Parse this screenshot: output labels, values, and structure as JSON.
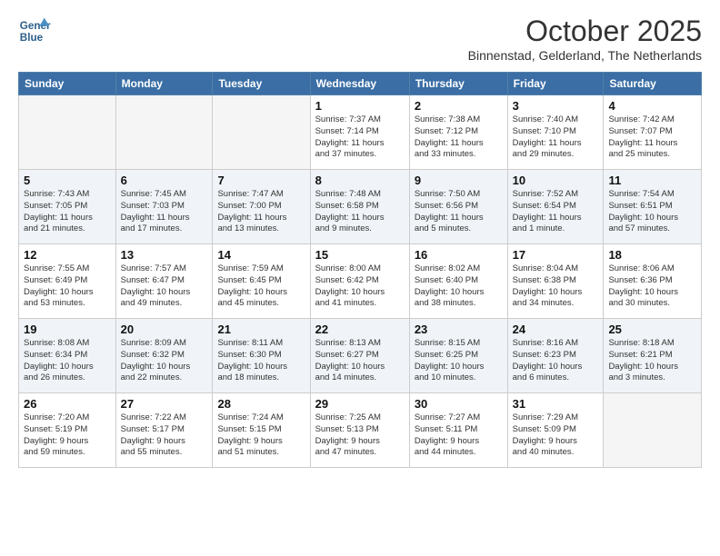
{
  "logo": {
    "text_line1": "General",
    "text_line2": "Blue"
  },
  "title": "October 2025",
  "location": "Binnenstad, Gelderland, The Netherlands",
  "weekdays": [
    "Sunday",
    "Monday",
    "Tuesday",
    "Wednesday",
    "Thursday",
    "Friday",
    "Saturday"
  ],
  "weeks": [
    [
      {
        "day": "",
        "info": ""
      },
      {
        "day": "",
        "info": ""
      },
      {
        "day": "",
        "info": ""
      },
      {
        "day": "1",
        "info": "Sunrise: 7:37 AM\nSunset: 7:14 PM\nDaylight: 11 hours\nand 37 minutes."
      },
      {
        "day": "2",
        "info": "Sunrise: 7:38 AM\nSunset: 7:12 PM\nDaylight: 11 hours\nand 33 minutes."
      },
      {
        "day": "3",
        "info": "Sunrise: 7:40 AM\nSunset: 7:10 PM\nDaylight: 11 hours\nand 29 minutes."
      },
      {
        "day": "4",
        "info": "Sunrise: 7:42 AM\nSunset: 7:07 PM\nDaylight: 11 hours\nand 25 minutes."
      }
    ],
    [
      {
        "day": "5",
        "info": "Sunrise: 7:43 AM\nSunset: 7:05 PM\nDaylight: 11 hours\nand 21 minutes."
      },
      {
        "day": "6",
        "info": "Sunrise: 7:45 AM\nSunset: 7:03 PM\nDaylight: 11 hours\nand 17 minutes."
      },
      {
        "day": "7",
        "info": "Sunrise: 7:47 AM\nSunset: 7:00 PM\nDaylight: 11 hours\nand 13 minutes."
      },
      {
        "day": "8",
        "info": "Sunrise: 7:48 AM\nSunset: 6:58 PM\nDaylight: 11 hours\nand 9 minutes."
      },
      {
        "day": "9",
        "info": "Sunrise: 7:50 AM\nSunset: 6:56 PM\nDaylight: 11 hours\nand 5 minutes."
      },
      {
        "day": "10",
        "info": "Sunrise: 7:52 AM\nSunset: 6:54 PM\nDaylight: 11 hours\nand 1 minute."
      },
      {
        "day": "11",
        "info": "Sunrise: 7:54 AM\nSunset: 6:51 PM\nDaylight: 10 hours\nand 57 minutes."
      }
    ],
    [
      {
        "day": "12",
        "info": "Sunrise: 7:55 AM\nSunset: 6:49 PM\nDaylight: 10 hours\nand 53 minutes."
      },
      {
        "day": "13",
        "info": "Sunrise: 7:57 AM\nSunset: 6:47 PM\nDaylight: 10 hours\nand 49 minutes."
      },
      {
        "day": "14",
        "info": "Sunrise: 7:59 AM\nSunset: 6:45 PM\nDaylight: 10 hours\nand 45 minutes."
      },
      {
        "day": "15",
        "info": "Sunrise: 8:00 AM\nSunset: 6:42 PM\nDaylight: 10 hours\nand 41 minutes."
      },
      {
        "day": "16",
        "info": "Sunrise: 8:02 AM\nSunset: 6:40 PM\nDaylight: 10 hours\nand 38 minutes."
      },
      {
        "day": "17",
        "info": "Sunrise: 8:04 AM\nSunset: 6:38 PM\nDaylight: 10 hours\nand 34 minutes."
      },
      {
        "day": "18",
        "info": "Sunrise: 8:06 AM\nSunset: 6:36 PM\nDaylight: 10 hours\nand 30 minutes."
      }
    ],
    [
      {
        "day": "19",
        "info": "Sunrise: 8:08 AM\nSunset: 6:34 PM\nDaylight: 10 hours\nand 26 minutes."
      },
      {
        "day": "20",
        "info": "Sunrise: 8:09 AM\nSunset: 6:32 PM\nDaylight: 10 hours\nand 22 minutes."
      },
      {
        "day": "21",
        "info": "Sunrise: 8:11 AM\nSunset: 6:30 PM\nDaylight: 10 hours\nand 18 minutes."
      },
      {
        "day": "22",
        "info": "Sunrise: 8:13 AM\nSunset: 6:27 PM\nDaylight: 10 hours\nand 14 minutes."
      },
      {
        "day": "23",
        "info": "Sunrise: 8:15 AM\nSunset: 6:25 PM\nDaylight: 10 hours\nand 10 minutes."
      },
      {
        "day": "24",
        "info": "Sunrise: 8:16 AM\nSunset: 6:23 PM\nDaylight: 10 hours\nand 6 minutes."
      },
      {
        "day": "25",
        "info": "Sunrise: 8:18 AM\nSunset: 6:21 PM\nDaylight: 10 hours\nand 3 minutes."
      }
    ],
    [
      {
        "day": "26",
        "info": "Sunrise: 7:20 AM\nSunset: 5:19 PM\nDaylight: 9 hours\nand 59 minutes."
      },
      {
        "day": "27",
        "info": "Sunrise: 7:22 AM\nSunset: 5:17 PM\nDaylight: 9 hours\nand 55 minutes."
      },
      {
        "day": "28",
        "info": "Sunrise: 7:24 AM\nSunset: 5:15 PM\nDaylight: 9 hours\nand 51 minutes."
      },
      {
        "day": "29",
        "info": "Sunrise: 7:25 AM\nSunset: 5:13 PM\nDaylight: 9 hours\nand 47 minutes."
      },
      {
        "day": "30",
        "info": "Sunrise: 7:27 AM\nSunset: 5:11 PM\nDaylight: 9 hours\nand 44 minutes."
      },
      {
        "day": "31",
        "info": "Sunrise: 7:29 AM\nSunset: 5:09 PM\nDaylight: 9 hours\nand 40 minutes."
      },
      {
        "day": "",
        "info": ""
      }
    ]
  ]
}
